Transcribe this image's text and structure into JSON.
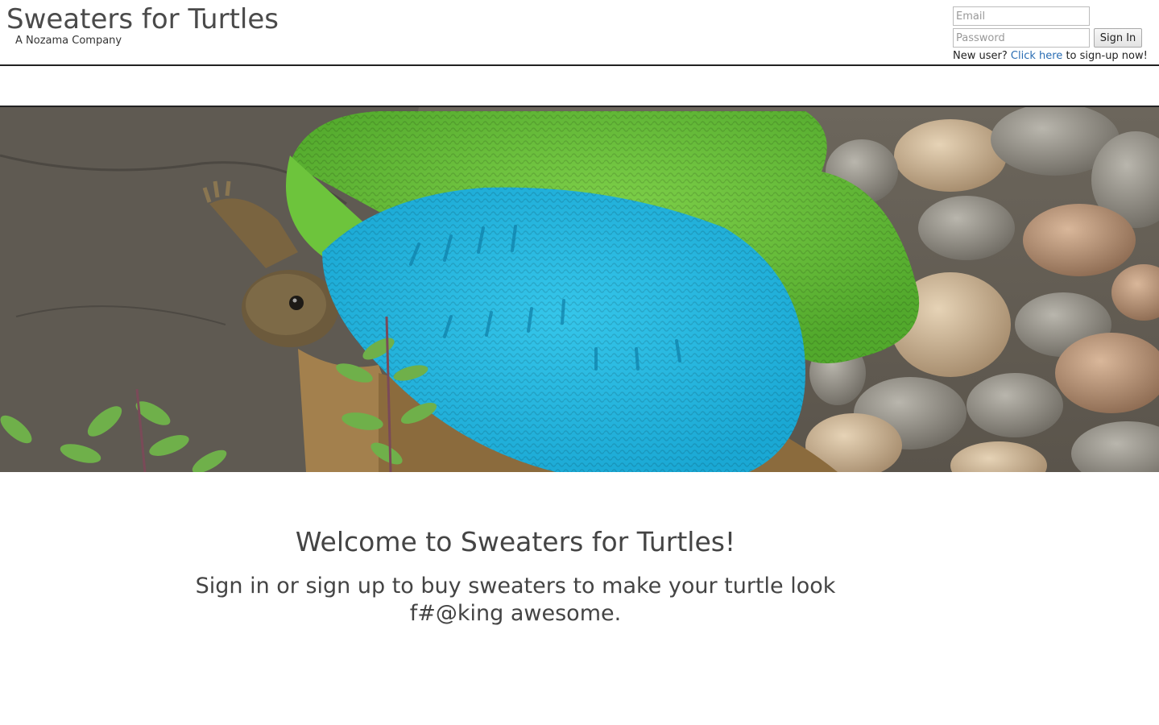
{
  "header": {
    "title": "Sweaters for Turtles",
    "subtitle": "A Nozama Company"
  },
  "login": {
    "email_placeholder": "Email",
    "password_placeholder": "Password",
    "signin_label": "Sign In",
    "new_user_prefix": "New user?",
    "signup_link": "Click here",
    "new_user_suffix": "to sign-up now!"
  },
  "hero": {
    "image": "turtle-in-knitted-sweater-photo"
  },
  "main": {
    "welcome": "Welcome to Sweaters for Turtles!",
    "tagline": "Sign in or sign up to buy sweaters to make your turtle look f#@king awesome."
  }
}
